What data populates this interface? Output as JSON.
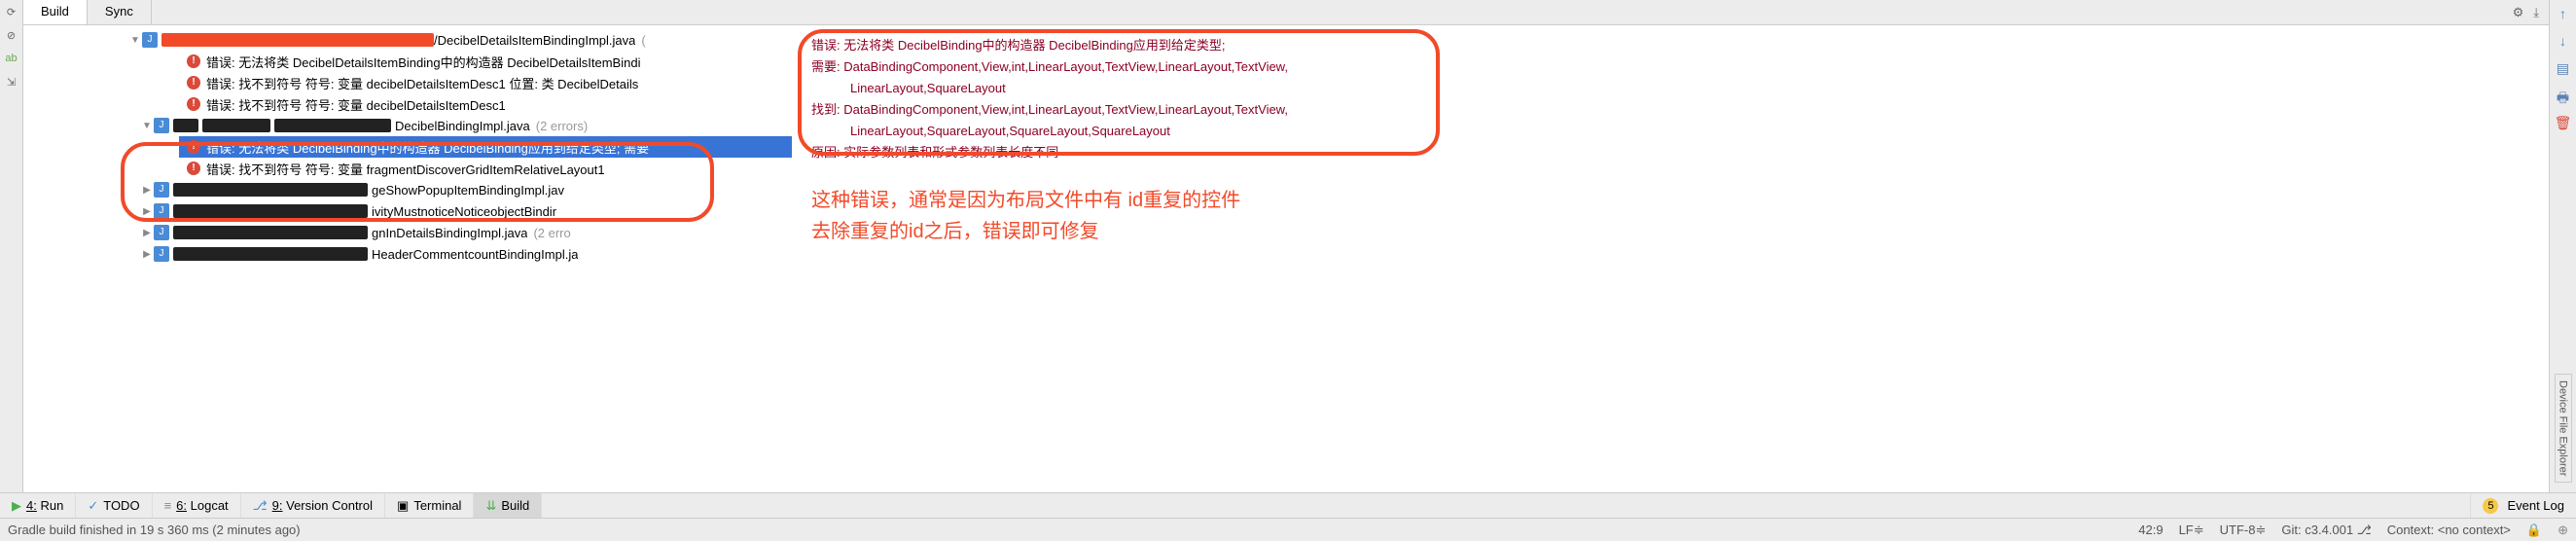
{
  "tabs": {
    "build": "Build",
    "sync": "Sync"
  },
  "tree": {
    "file1": "/DecibelDetailsItemBindingImpl.java",
    "file1_paren": "(",
    "err1": "错误: 无法将类 DecibelDetailsItemBinding中的构造器 DecibelDetailsItemBindi",
    "err2": "错误: 找不到符号 符号:   变量 decibelDetailsItemDesc1 位置: 类 DecibelDetails",
    "err3": "错误: 找不到符号 符号: 变量 decibelDetailsItemDesc1",
    "file2": "DecibelBindingImpl.java",
    "file2_count": "(2 errors)",
    "err_sel": "错误: 无法将类 DecibelBinding中的构造器 DecibelBinding应用到给定类型; 需要",
    "err4": "错误: 找不到符号 符号: 变量 fragmentDiscoverGridItemRelativeLayout1",
    "file3": "geShowPopupItemBindingImpl.jav",
    "file4": "ivityMustnoticeNoticeobjectBindir",
    "file5": "gnInDetailsBindingImpl.java",
    "file5_count": "(2 erro",
    "file6": "HeaderCommentcountBindingImpl.ja"
  },
  "detail": {
    "l1": "错误: 无法将类 DecibelBinding中的构造器 DecibelBinding应用到给定类型;",
    "l2": "需要: DataBindingComponent,View,int,LinearLayout,TextView,LinearLayout,TextView,",
    "l2b": "LinearLayout,SquareLayout",
    "l3": "找到: DataBindingComponent,View,int,LinearLayout,TextView,LinearLayout,TextView,",
    "l3b": "LinearLayout,SquareLayout,SquareLayout,SquareLayout",
    "l4": "原因: 实际参数列表和形式参数列表长度不同",
    "note1": "这种错误，通常是因为布局文件中有 id重复的控件",
    "note2": "去除重复的id之后，错误即可修复"
  },
  "bottomTabs": {
    "run": "Run",
    "run_n": "4:",
    "todo": "TODO",
    "logcat": "Logcat",
    "logcat_n": "6:",
    "vcs": "Version Control",
    "vcs_n": "9:",
    "terminal": "Terminal",
    "build": "Build",
    "eventlog": "Event Log",
    "eventlog_badge": "5"
  },
  "status": {
    "msg": "Gradle build finished in 19 s 360 ms (2 minutes ago)",
    "pos": "42:9",
    "lf": "LF",
    "enc": "UTF-8",
    "git": "Git: c3.4.001",
    "context": "Context: <no context>"
  },
  "rightTab": "Device File Explorer"
}
